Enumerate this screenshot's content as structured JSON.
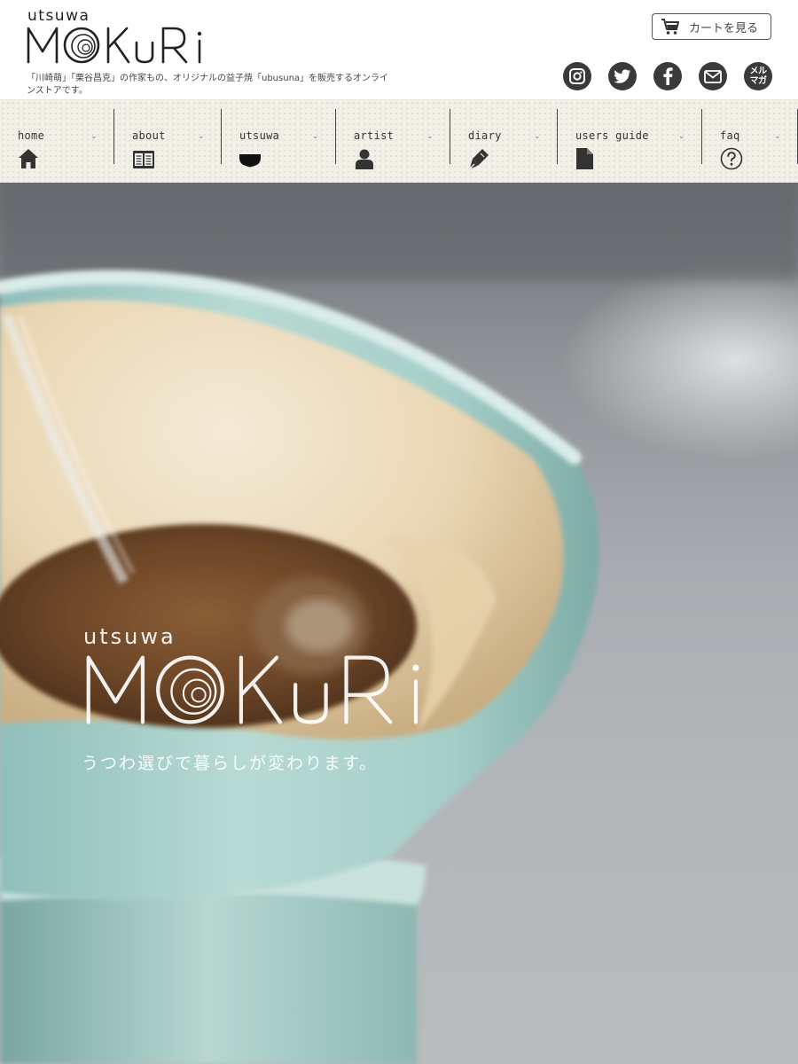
{
  "brand": {
    "small_word": "utsuwa",
    "name": "MOKURI",
    "tagline": "「川崎萌」「栗谷昌克」の作家もの、オリジナルの益子焼「ubusuna」を販売するオンラインストアです。"
  },
  "header": {
    "cart_label": "カートを見る",
    "cart_icon": "cart-icon",
    "social": [
      {
        "name": "instagram",
        "icon": "instagram-icon"
      },
      {
        "name": "twitter",
        "icon": "twitter-icon"
      },
      {
        "name": "facebook",
        "icon": "facebook-icon"
      },
      {
        "name": "mail",
        "icon": "mail-icon"
      },
      {
        "name": "mailmagazine",
        "icon": "mailmagazine-icon",
        "text": [
          "メル",
          "マガ"
        ]
      }
    ]
  },
  "nav": {
    "items": [
      {
        "label": "home",
        "icon": "home-icon"
      },
      {
        "label": "about",
        "icon": "book-icon"
      },
      {
        "label": "utsuwa",
        "icon": "bowl-icon"
      },
      {
        "label": "artist",
        "icon": "person-icon"
      },
      {
        "label": "diary",
        "icon": "pen-icon"
      },
      {
        "label": "users guide",
        "icon": "document-icon"
      },
      {
        "label": "faq",
        "icon": "question-icon"
      }
    ],
    "chevron": "⌄"
  },
  "hero": {
    "small_word": "utsuwa",
    "name": "MOKURI",
    "tagline": "うつわ選びで暮らしが変わります。"
  },
  "colors": {
    "nav_bg": "#f1efe6",
    "icon_dark": "#333333",
    "ceramic_blue": "#9cc8c4",
    "filter_paper": "#ead7b4",
    "coffee": "#7a5230"
  }
}
